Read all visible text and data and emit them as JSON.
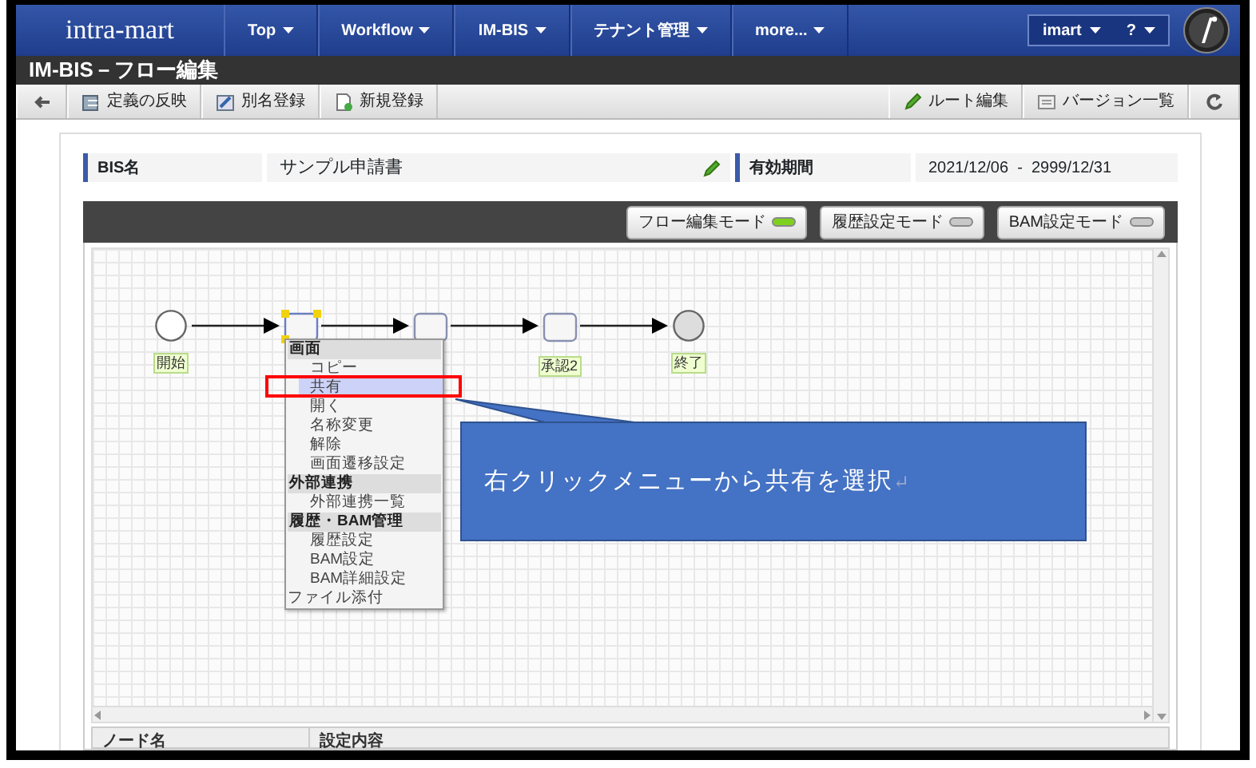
{
  "header": {
    "logo": "intra-mart",
    "menus": [
      {
        "label": "Top"
      },
      {
        "label": "Workflow"
      },
      {
        "label": "IM-BIS"
      },
      {
        "label": "テナント管理"
      },
      {
        "label": "more..."
      }
    ],
    "user": "imart",
    "help": "?"
  },
  "page_title": "IM-BIS－フロー編集",
  "toolbar": {
    "left": [
      {
        "kind": "back"
      },
      {
        "kind": "reflect",
        "label": "定義の反映"
      },
      {
        "kind": "alias",
        "label": "別名登録"
      },
      {
        "kind": "new",
        "label": "新規登録"
      }
    ],
    "right": [
      {
        "kind": "route",
        "label": "ルート編集"
      },
      {
        "kind": "versions",
        "label": "バージョン一覧"
      },
      {
        "kind": "refresh"
      }
    ]
  },
  "info": {
    "bis_label": "BIS名",
    "bis_value": "サンプル申請書",
    "period_label": "有効期間",
    "period_value": "2021/12/06  -  2999/12/31"
  },
  "modes": [
    {
      "label": "フロー編集モード",
      "selected": true
    },
    {
      "label": "履歴設定モード",
      "selected": false
    },
    {
      "label": "BAM設定モード",
      "selected": false
    }
  ],
  "flow": {
    "nodes": [
      {
        "kind": "start",
        "label": "開始"
      },
      {
        "kind": "task",
        "selected": true
      },
      {
        "kind": "task",
        "selected": false
      },
      {
        "kind": "task",
        "label": "承認2",
        "selected": false
      },
      {
        "kind": "end",
        "label": "終了"
      }
    ]
  },
  "context_menu": [
    {
      "kind": "header",
      "label": "画面",
      "selected": false
    },
    {
      "kind": "item",
      "label": "コピー",
      "selected": false
    },
    {
      "kind": "item",
      "label": "共有",
      "selected": true
    },
    {
      "kind": "item",
      "label": "開く",
      "selected": false
    },
    {
      "kind": "item",
      "label": "名称変更",
      "selected": false
    },
    {
      "kind": "item",
      "label": "解除",
      "selected": false
    },
    {
      "kind": "item",
      "label": "画面遷移設定",
      "selected": false
    },
    {
      "kind": "header",
      "label": "外部連携",
      "selected": false
    },
    {
      "kind": "item",
      "label": "外部連携一覧",
      "selected": false
    },
    {
      "kind": "header",
      "label": "履歴・BAM管理",
      "selected": false
    },
    {
      "kind": "item",
      "label": "履歴設定",
      "selected": false
    },
    {
      "kind": "item",
      "label": "BAM設定",
      "selected": false
    },
    {
      "kind": "item",
      "label": "BAM詳細設定",
      "selected": false
    },
    {
      "kind": "root",
      "label": "ファイル添付",
      "selected": false
    }
  ],
  "callout": {
    "text": "右クリックメニューから共有を選択",
    "mark": "↵"
  },
  "table": {
    "columns": [
      "ノード名",
      "設定内容"
    ]
  }
}
